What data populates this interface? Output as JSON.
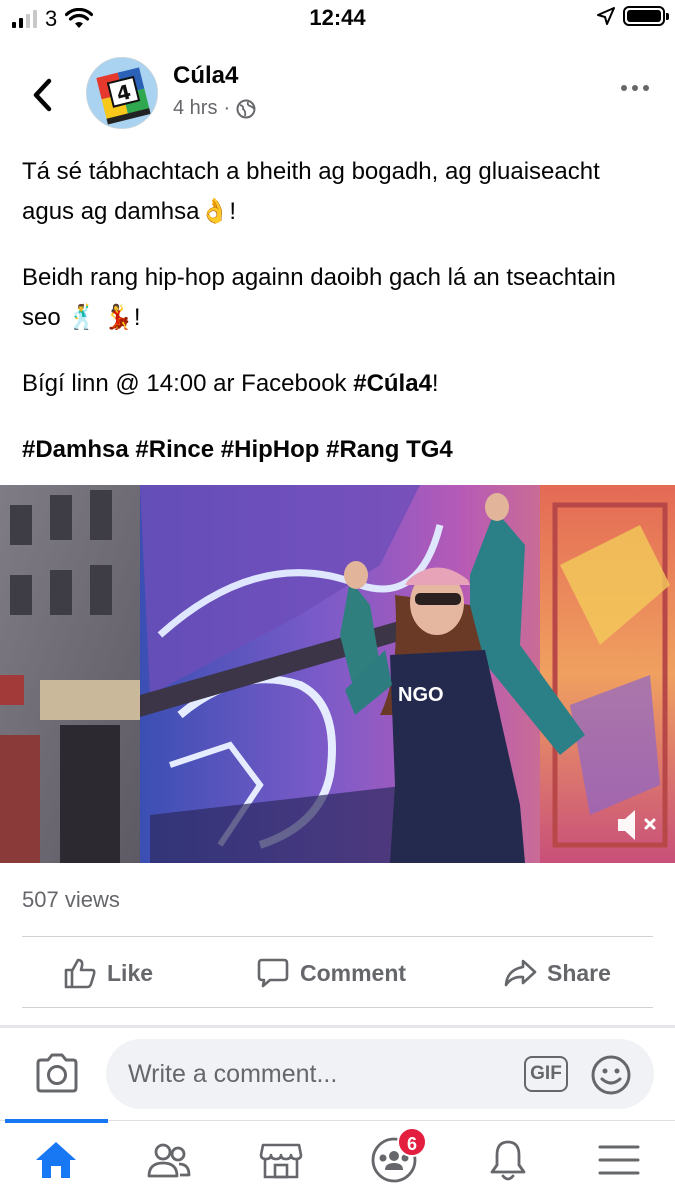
{
  "status_bar": {
    "carrier": "3",
    "time": "12:44"
  },
  "post": {
    "page_name": "Cúla4",
    "time_ago": "4 hrs",
    "separator": "·",
    "paragraphs": [
      {
        "text": "Tá sé tábhachtach a bheith ag bogadh, ag gluaiseacht agus ag damhsa",
        "emoji": "👌",
        "suffix": "!"
      },
      {
        "text": "Beidh rang hip-hop againn daoibh gach lá an tseachtain seo",
        "emoji": "🕺 💃",
        "suffix": "!"
      },
      {
        "text": "Bígí linn @ 14:00 ar Facebook ",
        "bold": "#Cúla4",
        "suffix": "!"
      }
    ],
    "hashtags": "#Damhsa #Rince #HipHop #Rang TG4",
    "views": "507 views"
  },
  "actions": {
    "like": "Like",
    "comment": "Comment",
    "share": "Share"
  },
  "comment_box": {
    "placeholder": "Write a comment...",
    "gif_label": "GIF"
  },
  "nav": {
    "groups_badge": "6"
  },
  "colors": {
    "accent": "#1877f2",
    "badge": "#e41e3f",
    "secondary_text": "#65676b"
  },
  "icons": [
    "back-icon",
    "globe-icon",
    "more-icon",
    "mute-icon",
    "like-icon",
    "comment-icon",
    "share-icon",
    "camera-icon",
    "emoji-icon",
    "home-icon",
    "friends-icon",
    "marketplace-icon",
    "groups-icon",
    "bell-icon",
    "menu-icon"
  ]
}
